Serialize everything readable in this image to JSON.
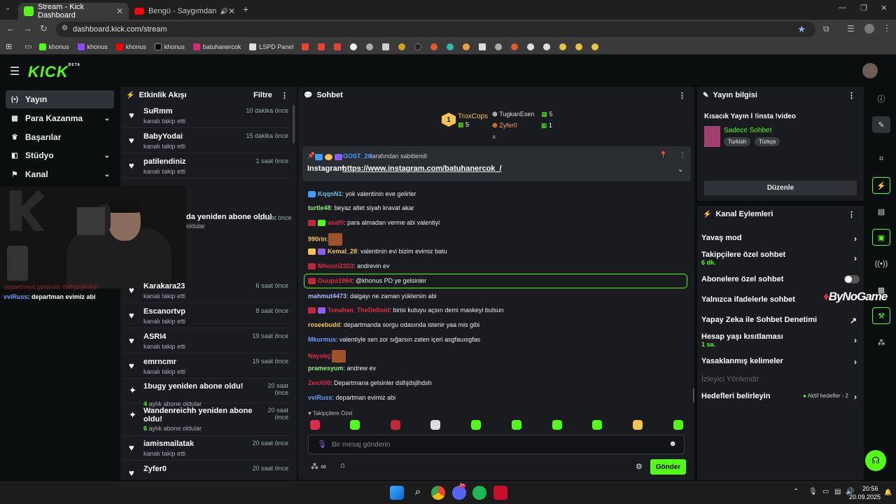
{
  "browser": {
    "tabs": [
      {
        "title": "Stream - Kick Dashboard"
      },
      {
        "title": "Bengü - Saygımdan (Alper"
      }
    ],
    "url": "dashboard.kick.com/stream",
    "bookmarks": [
      "khonus",
      "khonus",
      "khonus",
      "khonus",
      "batuhanercok",
      "LSPD Panel"
    ]
  },
  "app": {
    "logo": "KICK",
    "logo_tag": "BETA"
  },
  "nav": [
    {
      "label": "Yayın",
      "icon": "(•)"
    },
    {
      "label": "Para Kazanma",
      "icon": "▦"
    },
    {
      "label": "Başarılar",
      "icon": "🏆"
    },
    {
      "label": "Stüdyo",
      "icon": "◧"
    },
    {
      "label": "Kanal",
      "icon": "⚑"
    }
  ],
  "overlay": {
    "line1": "department gelsinler dsłhjdsjłhdsh",
    "line2_user": "vviRuss",
    "line2_text": ": departman evimiz abi",
    "fragment1": "da yeniden abone oldu!",
    "fragment2": "oldular",
    "fragment3": "1 saat önce"
  },
  "activity": {
    "title": "Etkinlik Akışı",
    "filter": "Filtre",
    "events": [
      {
        "name": "SuRmm",
        "sub": "kanalı takip etti",
        "time": "10 dakika önce",
        "icon": "heart"
      },
      {
        "name": "BabyYodai",
        "sub": "kanalı takip etti",
        "time": "15 dakika önce",
        "icon": "heart"
      },
      {
        "name": "patilendiniz",
        "sub": "kanalı takip etti",
        "time": "1 saat önce",
        "icon": "heart"
      },
      {
        "name": "",
        "sub": "",
        "time": "1 saat önce",
        "icon": "heart"
      },
      {
        "name": "",
        "sub": "",
        "time": "1 saat önce",
        "icon": "heart"
      },
      {
        "name": "",
        "sub": "",
        "time": "1 saat önce",
        "icon": "heart"
      },
      {
        "name": "",
        "sub": "",
        "time": "6 saat önce",
        "icon": "heart"
      },
      {
        "name": "Karakara23",
        "sub": "kanalı takip etti",
        "time": "6 saat önce",
        "icon": "heart"
      },
      {
        "name": "Escanortvp",
        "sub": "kanalı takip etti",
        "time": "8 saat önce",
        "icon": "heart"
      },
      {
        "name": "ASRI4",
        "sub": "kanalı takip etti",
        "time": "19 saat önce",
        "icon": "heart"
      },
      {
        "name": "emrncmr",
        "sub": "kanalı takip etti",
        "time": "19 saat önce",
        "icon": "heart"
      },
      {
        "name": "1bugy yeniden abone oldu!",
        "sub_num": "4",
        "sub": " aylık abone oldular",
        "time": "20 saat önce",
        "icon": "sparkle"
      },
      {
        "name": "Wandenreichh yeniden abone oldu!",
        "sub_num": "6",
        "sub": " aylık abone oldular",
        "time": "20 saat önce",
        "icon": "sparkle"
      },
      {
        "name": "iamismailatak",
        "sub": "kanalı takip etti",
        "time": "20 saat önce",
        "icon": "heart"
      },
      {
        "name": "Zyfer0",
        "sub": "",
        "time": "20 saat önce",
        "icon": "heart"
      }
    ]
  },
  "chat": {
    "title": "Sohbet",
    "leaders": [
      {
        "name": "TroxCops",
        "count": "5",
        "rank": "1"
      },
      {
        "name": "TugkanEsen",
        "count": "5"
      },
      {
        "name": "Zyfer0",
        "count": "1"
      }
    ],
    "pinned": {
      "by": "GOST_26",
      "by_suffix": "tarafından sabitlendi",
      "label": "Instagram:",
      "link": "https://www.instagram.com/batuhanercok_/"
    },
    "messages": [
      {
        "user": "KqqnN1",
        "color": "#62c1e5",
        "text": ": yok valentinin eve gelirler"
      },
      {
        "user": "turtle48",
        "color": "#93f07a",
        "text": ": beyaz atlet siyah kravat akar"
      },
      {
        "user": "asaf0",
        "color": "#e0294b",
        "text": ": para almadan verme abi valentiyi"
      },
      {
        "user": "990rin",
        "color": "#f6c453",
        "text": ":"
      },
      {
        "user": "Kemal_28",
        "color": "#f6c453",
        "text": ": valentinin evi bizim evimiz batu"
      },
      {
        "user": "Mhoozi2323",
        "color": "#e0294b",
        "text": ": andrevin ev"
      },
      {
        "user": "Ouupo1964",
        "color": "#e0294b",
        "text": ": @khonus PD ye gelsinler"
      },
      {
        "user": "mahmut4473",
        "color": "#a9b8ff",
        "text": ": dalgayı ne zaman yüklersin abi"
      },
      {
        "user": "Tunahan_TheDeltoid",
        "color": "#e0294b",
        "text": ": birisi kutuyu açsın demi maskeyi bulsun"
      },
      {
        "user": "roseebudd",
        "color": "#f6c453",
        "text": ": departmanda sorgu odasında istenir yaa mis gibi"
      },
      {
        "user": "Mkurmus",
        "color": "#62a0ff",
        "text": ": valentiyle sen zor sığarsın zaten içeri asgfauısgfas"
      },
      {
        "user": "Nayslej",
        "color": "#e0294b",
        "text": ":"
      },
      {
        "user": "pramesyum",
        "color": "#93f07a",
        "text": ": andrew ev"
      },
      {
        "user": "ZenX00",
        "color": "#e0294b",
        "text": ": Departmana gelsinler dslhjdsjlhdsh"
      },
      {
        "user": "vviRuss",
        "color": "#62a0ff",
        "text": ": departman evimiz abi"
      }
    ],
    "followers_only": "Takipçilere Özel",
    "input_placeholder": "Bir mesaj gönderin",
    "send": "Gönder",
    "infinity": "∞"
  },
  "stream_info": {
    "title": "Yayın bilgisi",
    "stream_title": "Kısacık Yayın l !insta !video",
    "category": "Sadece Sohbet",
    "tags": [
      "Turkish",
      "Türkçe"
    ],
    "edit": "Düzenle"
  },
  "channel_actions": {
    "title": "Kanal Eylemleri",
    "items": [
      {
        "label": "Yavaş mod",
        "sub": "",
        "right": "›"
      },
      {
        "label": "Takipçilere özel sohbet",
        "sub": "6 dk.",
        "right": "›"
      },
      {
        "label": "Abonelere özel sohbet",
        "sub": "",
        "right": "toggle"
      },
      {
        "label": "Yalnızca ifadelerle sohbet",
        "sub": "",
        "right": ""
      },
      {
        "label": "Yapay Zeka ile Sohbet Denetimi",
        "sub": "",
        "right": "↗"
      },
      {
        "label": "Hesap yaşı kısıtlaması",
        "sub": "1 sa.",
        "right": "›"
      },
      {
        "label": "Yasaklanmış kelimeler",
        "sub": "",
        "right": "›"
      },
      {
        "label": "İzleyici Yönlendir",
        "sub": "",
        "right": ""
      },
      {
        "label": "Hedefleri belirleyin",
        "sub": "",
        "right": "›",
        "status": "Aktif hedefler - 2"
      }
    ],
    "watermark": "ByNoGame"
  },
  "taskbar": {
    "time": "20:56",
    "date": "20.09.2025",
    "discord_badge": "2+"
  },
  "colors": {
    "accent": "#53fc18",
    "panel": "#191b1f",
    "bg": "#0b0e0f"
  }
}
